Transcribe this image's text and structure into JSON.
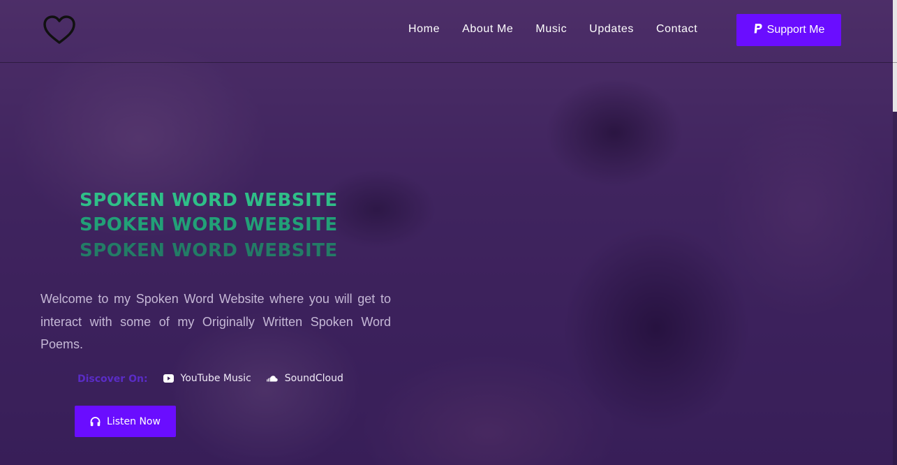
{
  "colors": {
    "accent": "#6a0dff",
    "headline_green": "#2fbf88",
    "discover_label": "#5a2cc6",
    "overlay": "#34185a"
  },
  "header": {
    "logo_icon": "heart-outline-icon",
    "nav": [
      {
        "label": "Home"
      },
      {
        "label": "About Me"
      },
      {
        "label": "Music"
      },
      {
        "label": "Updates"
      },
      {
        "label": "Contact"
      }
    ],
    "support": {
      "icon": "paypal-icon",
      "label": "Support Me"
    }
  },
  "hero": {
    "headline_lines": [
      "SPOKEN WORD WEBSITE",
      "SPOKEN WORD WEBSITE",
      "SPOKEN WORD WEBSITE"
    ],
    "description": "Welcome to my Spoken Word Website where you will get to interact with some of my Originally Written Spoken Word Poems.",
    "discover": {
      "label": "Discover On:",
      "platforms": [
        {
          "icon": "youtube-icon",
          "label": "YouTube Music"
        },
        {
          "icon": "soundcloud-icon",
          "label": "SoundCloud"
        }
      ]
    },
    "cta": {
      "icon": "headphones-icon",
      "label": "Listen Now"
    }
  }
}
